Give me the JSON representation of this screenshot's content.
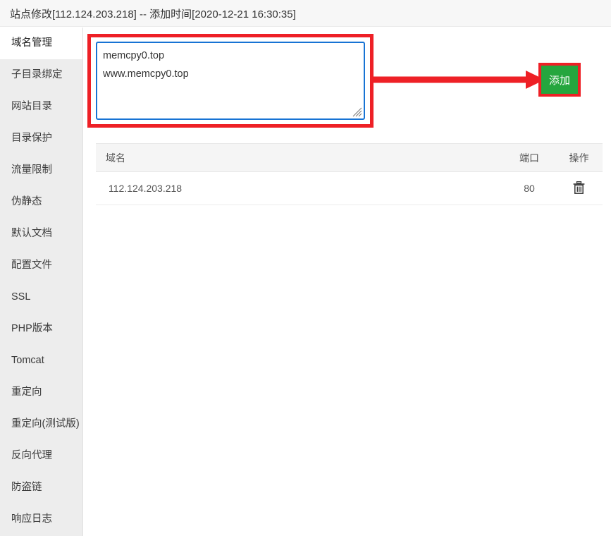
{
  "header": {
    "title": "站点修改[112.124.203.218] -- 添加时间[2020-12-21 16:30:35]"
  },
  "sidebar": {
    "items": [
      {
        "label": "域名管理",
        "active": true
      },
      {
        "label": "子目录绑定",
        "active": false
      },
      {
        "label": "网站目录",
        "active": false
      },
      {
        "label": "目录保护",
        "active": false
      },
      {
        "label": "流量限制",
        "active": false
      },
      {
        "label": "伪静态",
        "active": false
      },
      {
        "label": "默认文档",
        "active": false
      },
      {
        "label": "配置文件",
        "active": false
      },
      {
        "label": "SSL",
        "active": false
      },
      {
        "label": "PHP版本",
        "active": false
      },
      {
        "label": "Tomcat",
        "active": false
      },
      {
        "label": "重定向",
        "active": false
      },
      {
        "label": "重定向(测试版)",
        "active": false
      },
      {
        "label": "反向代理",
        "active": false
      },
      {
        "label": "防盗链",
        "active": false
      },
      {
        "label": "响应日志",
        "active": false
      }
    ]
  },
  "main": {
    "domain_input": {
      "value": "memcpy0.top\nwww.memcpy0.top",
      "placeholder": ""
    },
    "add_button": {
      "label": "添加"
    },
    "annotation": {
      "box_color": "#ee2026",
      "arrow_color": "#ee2026",
      "button_color": "#25a63e",
      "input_border_color": "#1773d4"
    },
    "table": {
      "columns": [
        "域名",
        "端口",
        "操作"
      ],
      "rows": [
        {
          "domain": "112.124.203.218",
          "port": "80",
          "action_icon": "trash-icon"
        }
      ]
    }
  }
}
